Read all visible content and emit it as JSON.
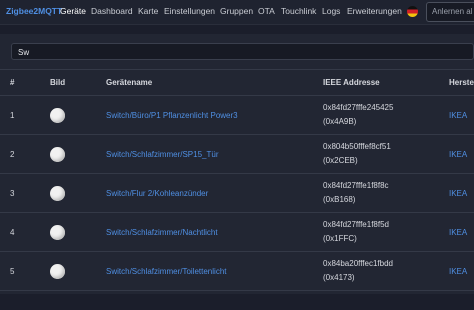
{
  "nav": {
    "brand": "Zigbee2MQTT",
    "items": [
      "Geräte",
      "Dashboard",
      "Karte",
      "Einstellungen",
      "Gruppen",
      "OTA",
      "Touchlink",
      "Logs",
      "Erweiterungen"
    ],
    "login_placeholder": "Anlernen al"
  },
  "search": {
    "value": "Sw"
  },
  "table": {
    "headers": [
      "#",
      "Bild",
      "Gerätename",
      "IEEE Addresse",
      "Hersteller"
    ],
    "rows": [
      {
        "num": "1",
        "name": "Switch/Büro/P1 Pflanzenlicht Power3",
        "ieee": "0x84fd27fffe245425",
        "nwk": "(0x4A9B)",
        "manufacturer": "IKEA"
      },
      {
        "num": "2",
        "name": "Switch/Schlafzimmer/SP15_Tür",
        "ieee": "0x804b50fffef8cf51",
        "nwk": "(0x2CEB)",
        "manufacturer": "IKEA"
      },
      {
        "num": "3",
        "name": "Switch/Flur 2/Kohleanzünder",
        "ieee": "0x84fd27fffe1f8f8c",
        "nwk": "(0xB168)",
        "manufacturer": "IKEA"
      },
      {
        "num": "4",
        "name": "Switch/Schlafzimmer/Nachtlicht",
        "ieee": "0x84fd27fffe1f8f5d",
        "nwk": "(0x1FFC)",
        "manufacturer": "IKEA"
      },
      {
        "num": "5",
        "name": "Switch/Schlafzimmer/Toilettenlicht",
        "ieee": "0x84ba20fffec1fbdd",
        "nwk": "(0x4173)",
        "manufacturer": "IKEA"
      }
    ]
  }
}
